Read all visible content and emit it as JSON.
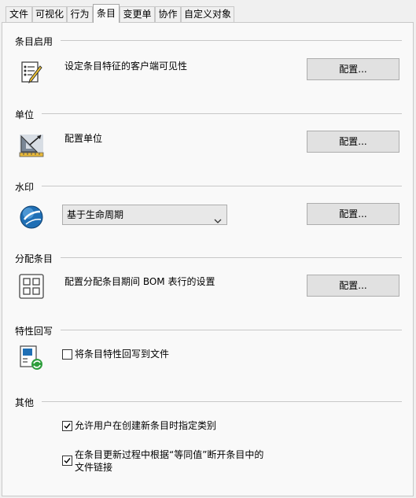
{
  "tabs": [
    {
      "label": "文件"
    },
    {
      "label": "可视化"
    },
    {
      "label": "行为"
    },
    {
      "label": "条目",
      "active": true
    },
    {
      "label": "变更单"
    },
    {
      "label": "协作"
    },
    {
      "label": "自定义对象"
    }
  ],
  "sections": {
    "item_enable": {
      "title": "条目启用",
      "description": "设定条目特征的客户端可见性",
      "button": "配置...",
      "icon": "properties-pencil-icon"
    },
    "units": {
      "title": "单位",
      "description": "配置单位",
      "button": "配置...",
      "icon": "ruler-triangle-icon"
    },
    "watermark": {
      "title": "水印",
      "select_value": "基于生命周期",
      "button": "配置...",
      "icon": "globe-icon"
    },
    "assign_items": {
      "title": "分配条目",
      "description": "配置分配条目期间 BOM 表行的设置",
      "button": "配置...",
      "icon": "grid-icon"
    },
    "writeback": {
      "title": "特性回写",
      "checkbox_label": "将条目特性回写到文件",
      "checked": false,
      "icon": "writeback-sync-icon"
    },
    "other": {
      "title": "其他",
      "allow_category": {
        "label": "允许用户在创建新条目时指定类别",
        "checked": true
      },
      "break_link": {
        "label_line1": "在条目更新过程中根据“等同值”断开条目中的",
        "label_line2": "文件链接",
        "checked": true
      }
    }
  },
  "colors": {
    "accent": "#1f6fb5",
    "panel_bg": "#f9f9f9",
    "button_bg": "#e1e1e1"
  }
}
